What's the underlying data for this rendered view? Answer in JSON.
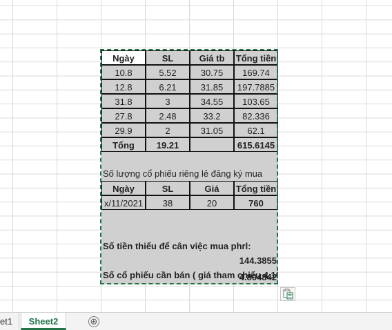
{
  "sheet": {
    "rows": [
      {
        "cells": [
          "Ngày",
          "SL",
          "Giá tb",
          "Tổng tiền"
        ]
      },
      {
        "cells": [
          "10.8",
          "5.52",
          "30.75",
          "169.74"
        ]
      },
      {
        "cells": [
          "12.8",
          "6.21",
          "31.85",
          "197.7885"
        ]
      },
      {
        "cells": [
          "31.8",
          "3",
          "34.55",
          "103.65"
        ]
      },
      {
        "cells": [
          "27.8",
          "2.48",
          "33.2",
          "82.336"
        ]
      },
      {
        "cells": [
          "29.9",
          "2",
          "31.05",
          "62.1"
        ]
      },
      {
        "cells": [
          "Tổng",
          "19.21",
          "",
          "615.6145"
        ]
      },
      {
        "cells": [
          "",
          "",
          "",
          ""
        ]
      },
      {
        "merged": "Số lượng cổ  phiếu riêng lẻ đăng ký mua"
      },
      {
        "cells": [
          "Ngày",
          "SL",
          "Giá",
          "Tổng tiền"
        ]
      },
      {
        "cells": [
          "x/11/2021",
          "38",
          "20",
          "760"
        ]
      },
      {
        "cells": [
          "",
          "",
          "",
          ""
        ]
      },
      {
        "cells": [
          "",
          "",
          "",
          ""
        ]
      },
      {
        "merged": "Số tiền thiếu để cân việc mua phrl:"
      },
      {
        "cells": [
          "",
          "",
          "",
          "144.3855"
        ]
      },
      {
        "merged": "Số cổ phiếu cần bán ( giá tham chiếu 4.10"
      },
      {
        "cells": [
          "",
          "",
          "",
          "4.804842"
        ]
      }
    ]
  },
  "tabs": {
    "sheet1_label": "et1",
    "sheet2_label": "Sheet2",
    "add_icon": "⊕"
  },
  "icons": {
    "paste_options": "paste-options-icon"
  },
  "colors": {
    "selection": "#217346",
    "range_fill": "#d0d0d0"
  }
}
